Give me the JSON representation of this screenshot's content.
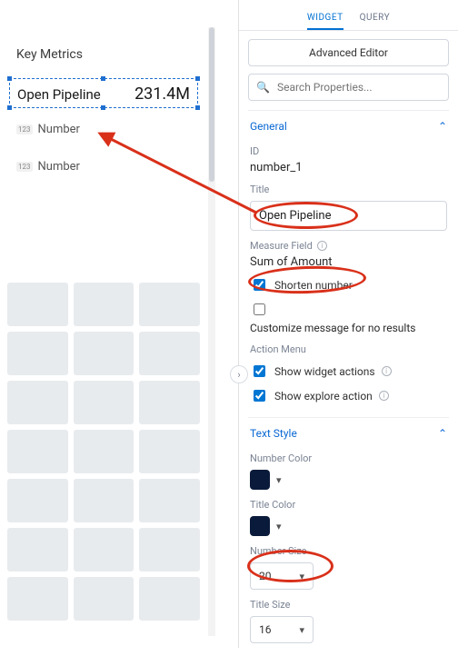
{
  "canvas": {
    "section_title": "Key Metrics",
    "selected_widget": {
      "title": "Open Pipeline",
      "value": "231.4M"
    },
    "placeholder_rows": [
      {
        "label": "Number",
        "icon_text": "123"
      },
      {
        "label": "Number",
        "icon_text": "123"
      }
    ]
  },
  "tabs": {
    "widget": "WIDGET",
    "query": "QUERY",
    "active": "widget"
  },
  "advanced_editor_label": "Advanced Editor",
  "search": {
    "placeholder": "Search Properties..."
  },
  "general": {
    "header": "General",
    "id_label": "ID",
    "id_value": "number_1",
    "title_label": "Title",
    "title_value": "Open Pipeline",
    "measure_field_label": "Measure Field",
    "measure_field_value": "Sum of Amount",
    "shorten_number": {
      "label": "Shorten number",
      "checked": true
    },
    "customize_message_label": "Customize message for no results",
    "action_menu_label": "Action Menu",
    "show_widget_actions": {
      "label": "Show widget actions",
      "checked": true
    },
    "show_explore_action": {
      "label": "Show explore action",
      "checked": true
    }
  },
  "text_style": {
    "header": "Text Style",
    "number_color_label": "Number Color",
    "number_color": "#0a1a3a",
    "title_color_label": "Title Color",
    "title_color": "#0a1a3a",
    "number_size_label": "Number Size",
    "number_size_value": "20",
    "title_size_label": "Title Size",
    "title_size_value": "16"
  }
}
